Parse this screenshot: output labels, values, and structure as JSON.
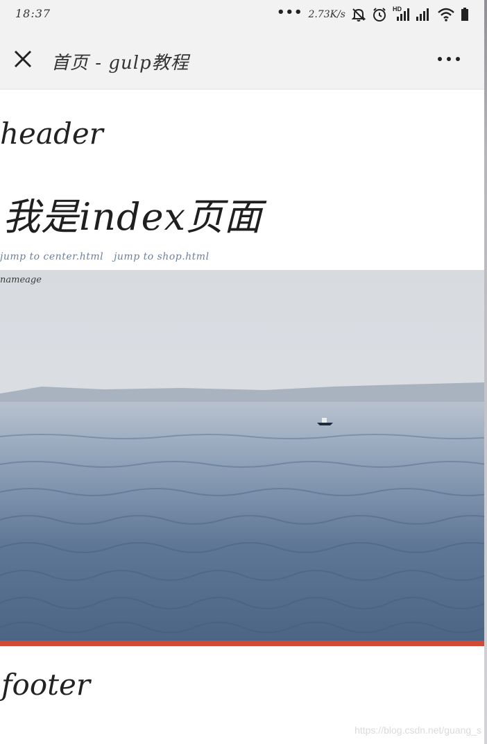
{
  "status_bar": {
    "time": "18:37",
    "net_speed": "2.73K/s",
    "hd_label": "HD"
  },
  "nav": {
    "title": "首页 - gulp教程"
  },
  "content": {
    "header_text": "header",
    "heading": "我是index页面",
    "links": [
      {
        "label": "jump to center.html"
      },
      {
        "label": "jump to shop.html"
      }
    ],
    "image_label": "nameage",
    "footer_text": "footer"
  },
  "watermark": "https://blog.csdn.net/guang_s",
  "colors": {
    "accent_bar": "#d04a36",
    "link": "#6b7f9e",
    "bar_bg": "#f2f2f2"
  },
  "icons": [
    "close-icon",
    "more-icon",
    "mute-icon",
    "alarm-icon",
    "signal-icon",
    "wifi-icon",
    "battery-icon"
  ]
}
